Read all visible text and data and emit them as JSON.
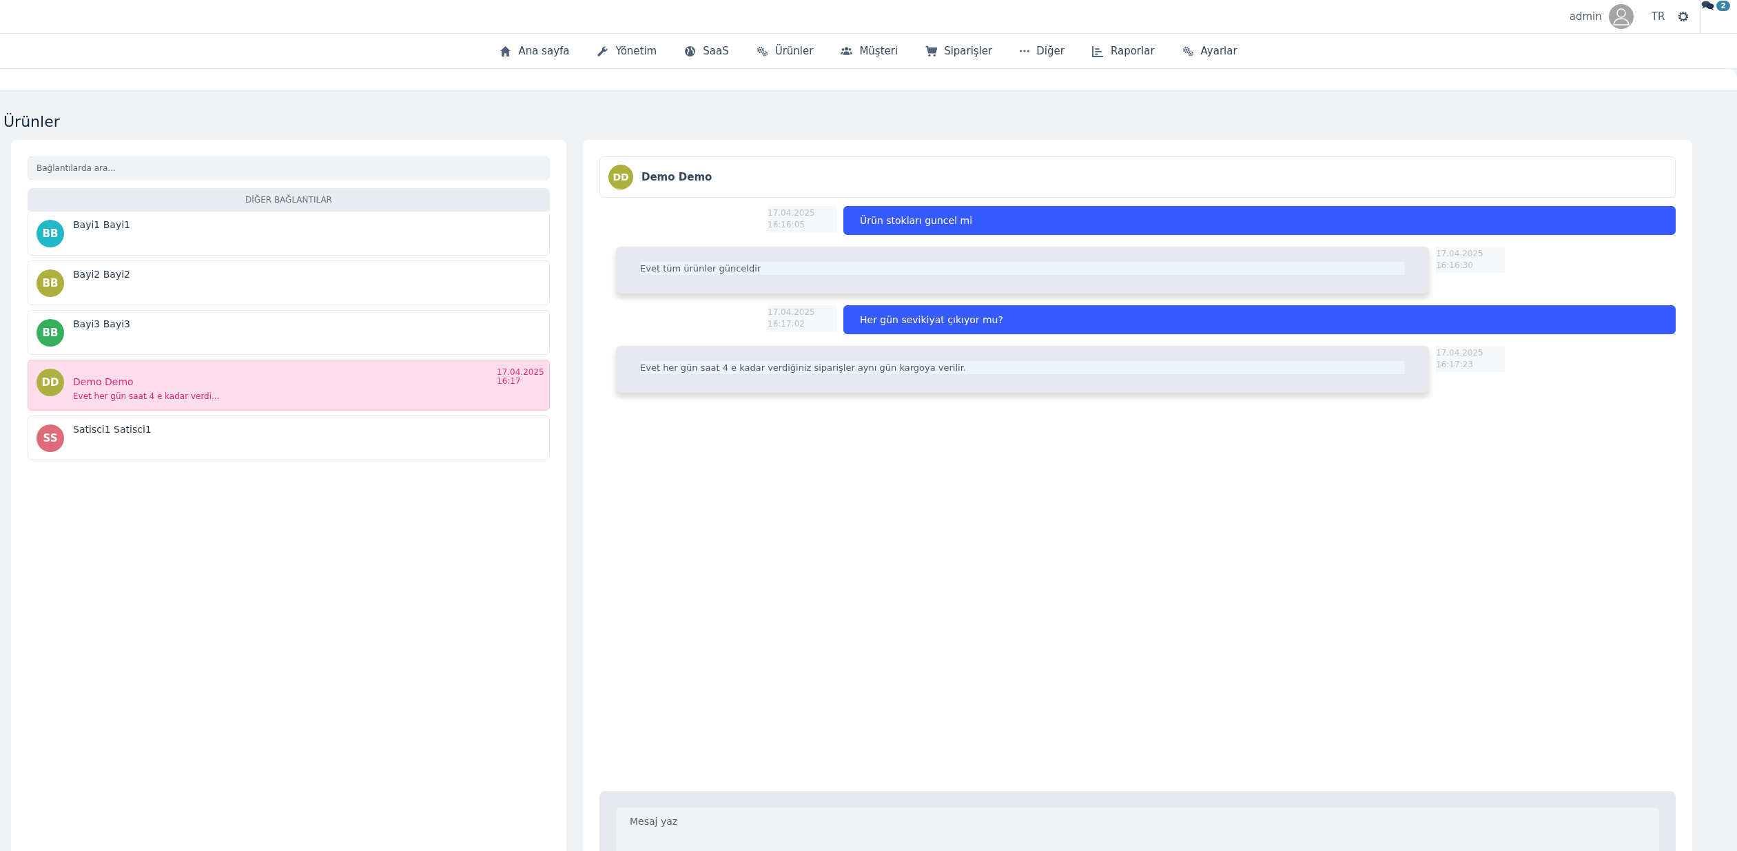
{
  "top_bar": {
    "user": "admin",
    "language": "TR",
    "notification_count": "2"
  },
  "nav": [
    {
      "label": "Ana sayfa"
    },
    {
      "label": "Yönetim"
    },
    {
      "label": "SaaS"
    },
    {
      "label": "Ürünler"
    },
    {
      "label": "Müşteri"
    },
    {
      "label": "Siparişler"
    },
    {
      "label": "Diğer"
    },
    {
      "label": "Raporlar"
    },
    {
      "label": "Ayarlar"
    }
  ],
  "page_title": "Ürünler",
  "contacts": {
    "search": {
      "placeholder": "Bağlantılarda ara..."
    },
    "header": "DİĞER BAĞLANTILAR",
    "items": [
      {
        "initials": "BB",
        "name": "Bayi1 Bayi1",
        "color": "#22b8c8",
        "selected": false
      },
      {
        "initials": "BB",
        "name": "Bayi2 Bayi2",
        "color": "#aeb03d",
        "selected": false
      },
      {
        "initials": "BB",
        "name": "Bayi3 Bayi3",
        "color": "#35b05c",
        "selected": false
      },
      {
        "initials": "DD",
        "name": "Demo Demo",
        "color": "#aeb03d",
        "selected": true,
        "time": "17.04.2025 16:17",
        "preview": "Evet her gün saat 4 e kadar verdi..."
      },
      {
        "initials": "SS",
        "name": "Satisci1 Satisci1",
        "color": "#e06b78",
        "selected": false
      }
    ]
  },
  "chat": {
    "header": {
      "initials": "DD",
      "name": "Demo Demo",
      "color": "#aeb03d"
    },
    "messages": [
      {
        "kind": "sent",
        "text": "Ürün stokları guncel mi",
        "date": "17.04.2025",
        "time": "16:16:05"
      },
      {
        "kind": "received",
        "text": "Evet tüm ürünler günceldir",
        "date": "17.04.2025",
        "time": "16:16:30"
      },
      {
        "kind": "sent",
        "text": "Her gün sevikiyat çıkıyor mu?",
        "date": "17.04.2025",
        "time": "16:17:02"
      },
      {
        "kind": "received",
        "text": "Evet her gün saat 4 e kadar verdiğiniz siparişler aynı gün kargoya verilir.",
        "date": "17.04.2025",
        "time": "16:17:23"
      }
    ],
    "input": {
      "placeholder": "Mesaj yaz"
    }
  }
}
